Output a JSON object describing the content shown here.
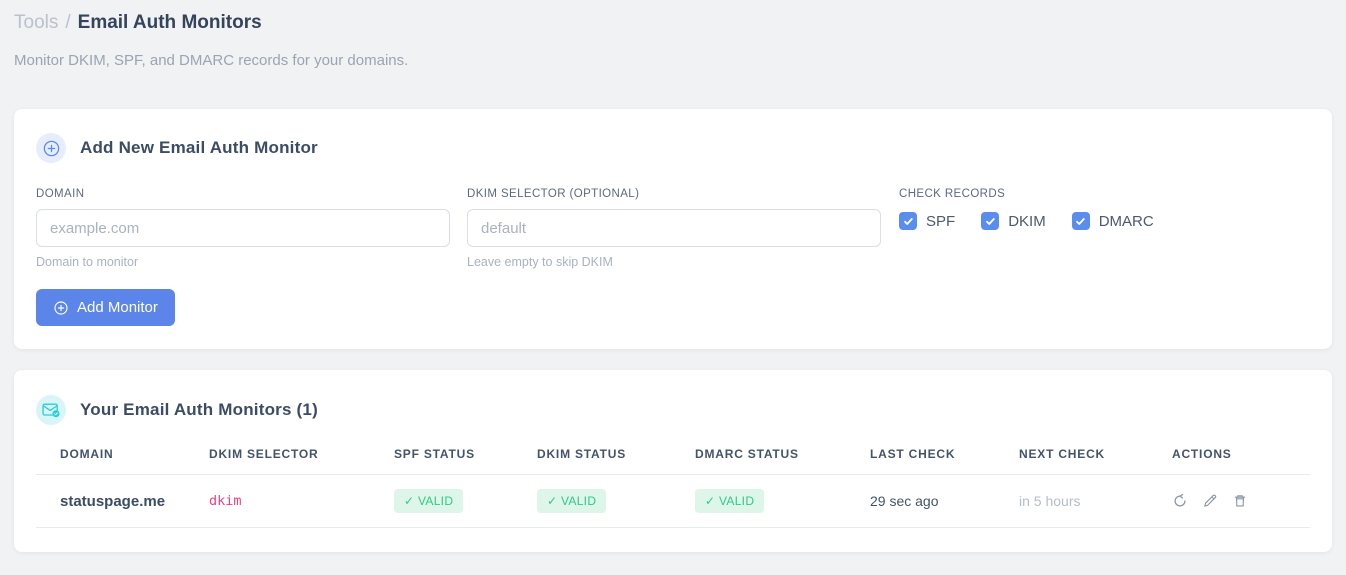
{
  "breadcrumb": {
    "section": "Tools",
    "separator": "/",
    "current": "Email Auth Monitors"
  },
  "page": {
    "subtitle": "Monitor DKIM, SPF, and DMARC records for your domains."
  },
  "add_monitor_card": {
    "title": "Add New Email Auth Monitor",
    "domain_field": {
      "label": "DOMAIN",
      "placeholder": "example.com",
      "value": "",
      "hint": "Domain to monitor"
    },
    "dkim_field": {
      "label": "DKIM SELECTOR (OPTIONAL)",
      "placeholder": "default",
      "value": "",
      "hint": "Leave empty to skip DKIM"
    },
    "check_records": {
      "label": "CHECK RECORDS",
      "options": [
        {
          "label": "SPF",
          "checked": true
        },
        {
          "label": "DKIM",
          "checked": true
        },
        {
          "label": "DMARC",
          "checked": true
        }
      ]
    },
    "submit_label": "Add Monitor"
  },
  "monitors_card": {
    "title": "Your Email Auth Monitors (1)",
    "count": 1,
    "table": {
      "headers": [
        "DOMAIN",
        "DKIM SELECTOR",
        "SPF STATUS",
        "DKIM STATUS",
        "DMARC STATUS",
        "LAST CHECK",
        "NEXT CHECK",
        "ACTIONS"
      ],
      "rows": [
        {
          "domain": "statuspage.me",
          "dkim_selector": "dkim",
          "spf_status": "✓ VALID",
          "dkim_status": "✓ VALID",
          "dmarc_status": "✓ VALID",
          "last_check": "29 sec ago",
          "next_check": "in 5 hours"
        }
      ]
    }
  },
  "icons": {
    "add_header": "plus-circle-icon",
    "monitors_header": "envelope-check-icon",
    "actions": [
      "refresh-icon",
      "pencil-icon",
      "trash-icon"
    ]
  },
  "colors": {
    "accent_blue": "#5b85e8",
    "checkbox_blue": "#5a8dee",
    "valid_green_text": "#2fcb81",
    "valid_green_bg": "#def5e9",
    "selector_pink": "#e8437e",
    "icon_teal": "#29ced6",
    "page_background": "#f1f2f4"
  }
}
